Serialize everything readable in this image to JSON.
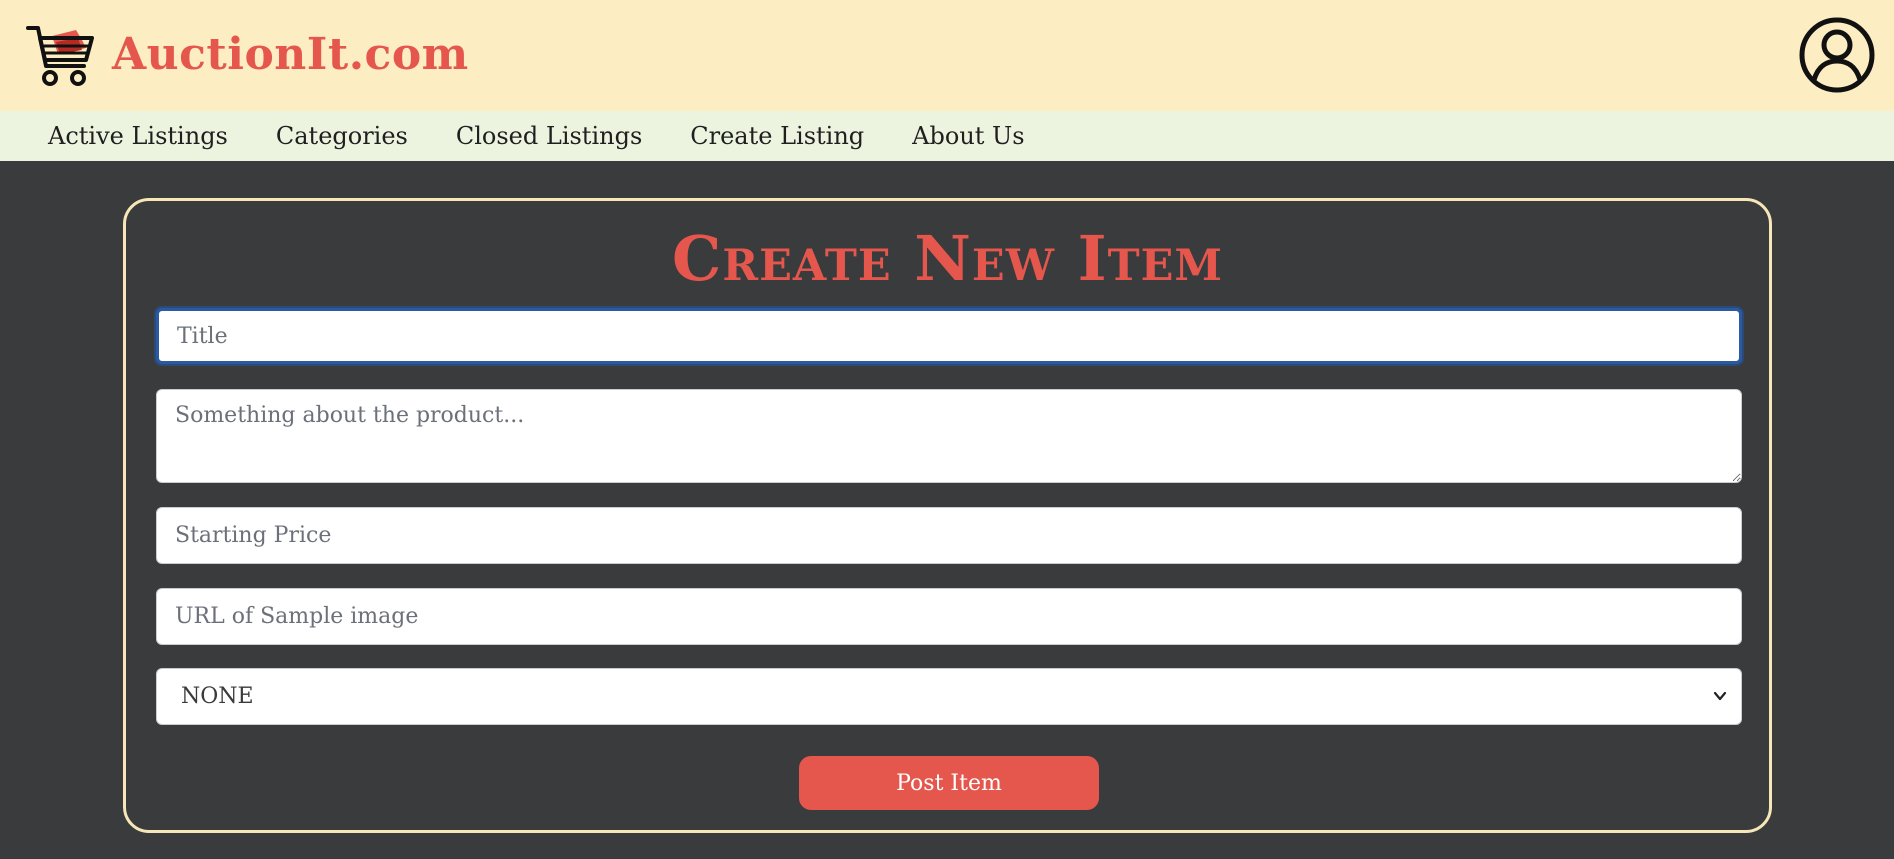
{
  "header": {
    "brand": "AuctionIt.com",
    "logo_icon": "shopping-cart-icon",
    "account_icon": "user-circle-icon"
  },
  "nav": {
    "items": [
      {
        "label": "Active Listings"
      },
      {
        "label": "Categories"
      },
      {
        "label": "Closed Listings"
      },
      {
        "label": "Create Listing"
      },
      {
        "label": "About Us"
      }
    ]
  },
  "form": {
    "title": "Create New Item",
    "title_field": {
      "value": "",
      "placeholder": "Title"
    },
    "description_field": {
      "value": "",
      "placeholder": "Something about the product..."
    },
    "price_field": {
      "value": "",
      "placeholder": "Starting Price"
    },
    "image_url_field": {
      "value": "",
      "placeholder": "URL of Sample image"
    },
    "category_select": {
      "selected": "NONE"
    },
    "submit_label": "Post Item"
  },
  "colors": {
    "header_bg": "#fcedc2",
    "nav_bg": "#ecf4e0",
    "page_bg": "#3a3b3d",
    "accent": "#e5574d",
    "card_border": "#f7e6b8"
  }
}
